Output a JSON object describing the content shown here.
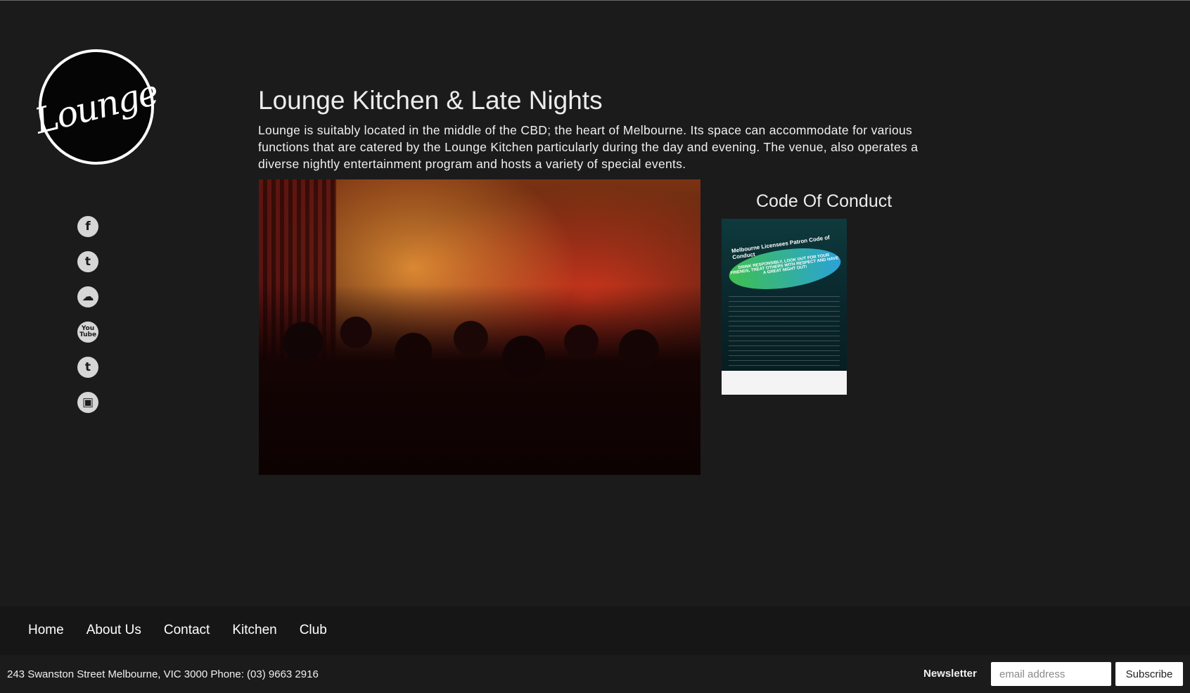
{
  "brand": {
    "logo_text": "Lounge"
  },
  "social": {
    "items": [
      {
        "name": "facebook",
        "glyph": "f"
      },
      {
        "name": "twitter",
        "glyph": "t"
      },
      {
        "name": "soundcloud",
        "glyph": "☁"
      },
      {
        "name": "youtube",
        "glyph": "You Tube"
      },
      {
        "name": "tumblr",
        "glyph": "t"
      },
      {
        "name": "instagram",
        "glyph": "▣"
      }
    ]
  },
  "main": {
    "title": "Lounge Kitchen & Late Nights",
    "intro": "Lounge is suitably located in the middle of the CBD; the heart of Melbourne. Its space can accommodate for various functions that are catered by the Lounge Kitchen particularly during the day and evening. The venue, also operates a diverse nightly entertainment program and hosts a variety of special events."
  },
  "conduct": {
    "title": "Code Of Conduct",
    "poster_heading": "Melbourne Licensees Patron Code of Conduct",
    "poster_bubble": "DRINK RESPONSIBLY, LOOK OUT FOR YOUR FRIENDS, TREAT OTHERS WITH RESPECT AND HAVE A GREAT NIGHT OUT!"
  },
  "footer": {
    "nav": [
      "Home",
      "About Us",
      "Contact",
      "Kitchen",
      "Club"
    ],
    "address": "243 Swanston Street Melbourne, VIC 3000 Phone: (03) 9663 2916",
    "newsletter_label": "Newsletter",
    "email_placeholder": "email address",
    "subscribe_label": "Subscribe"
  }
}
